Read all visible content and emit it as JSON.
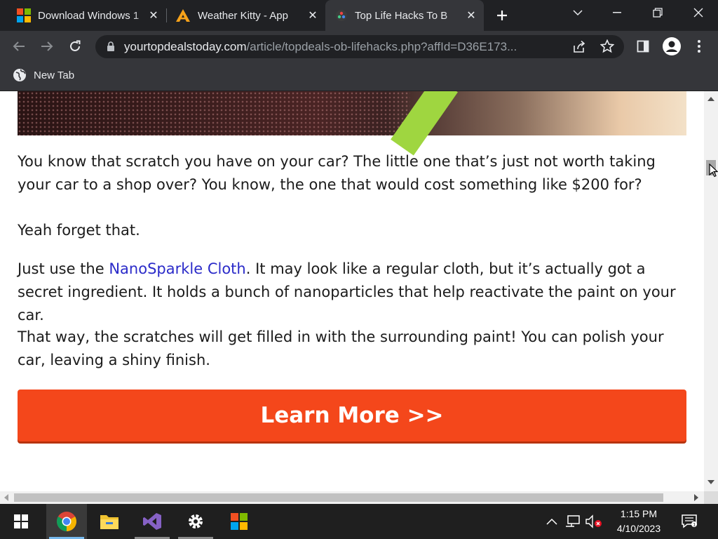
{
  "browser": {
    "tabs": [
      {
        "title": "Download Windows 1",
        "icon": "microsoft-logo-icon",
        "active": false
      },
      {
        "title": "Weather Kitty - App",
        "icon": "weather-kitty-a-icon",
        "active": false
      },
      {
        "title": "Top Life Hacks To B",
        "icon": "site-favicon-icon",
        "active": true
      }
    ],
    "new_tab_icon": "plus-icon",
    "address": {
      "host": "yourtopdealstoday.com",
      "path": "/article/topdeals-ob-lifehacks.php?affId=D36E173..."
    },
    "bookmarks": [
      {
        "label": "New Tab",
        "icon": "globe-icon"
      }
    ]
  },
  "article": {
    "p1": "You know that scratch you have on your car? The little one that’s just not worth taking your car to a shop over? You know, the one that would cost something like $200 for?",
    "p2": "Yeah forget that.",
    "p3_before": "Just use the ",
    "p3_link": "NanoSparkle Cloth",
    "p3_after": ". It may look like a regular cloth, but it’s actually got a secret ingredient. It holds a bunch of nanoparticles that help reactivate the paint on your car.",
    "p4": "That way, the scratches will get filled in with the surrounding paint! You can polish your car, leaving a shiny finish.",
    "cta_label": "Learn More >>"
  },
  "taskbar": {
    "time": "1:15 PM",
    "date": "4/10/2023",
    "apps": [
      "chrome-icon",
      "file-explorer-icon",
      "visual-studio-icon",
      "settings-gear-icon",
      "microsoft-store-icon"
    ]
  },
  "colors": {
    "cta": "#f4471b",
    "link": "#2b2bc9",
    "titlebar": "#202124",
    "toolbar": "#35363a"
  }
}
